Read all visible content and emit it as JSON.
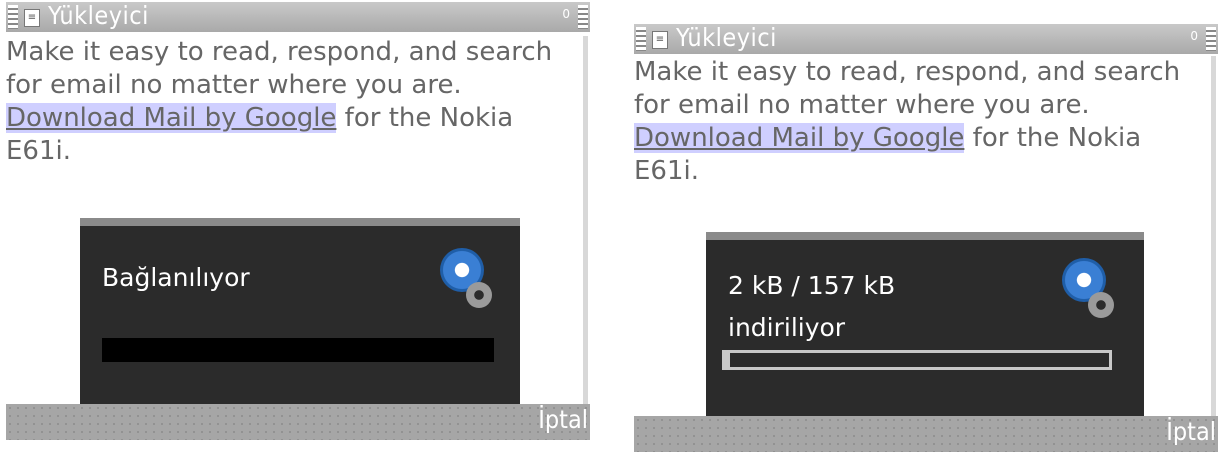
{
  "left_screen": {
    "titlebar": {
      "title": "Yükleyici",
      "counter": "0"
    },
    "content": {
      "line1": "Make it easy to read, respond, and search for email no matter where you are.",
      "link": "Download Mail by Google",
      "after_link": " for the Nokia E61i."
    },
    "dialog": {
      "status": "Bağlanılıyor"
    },
    "softkeys": {
      "right": "İptal"
    }
  },
  "right_screen": {
    "titlebar": {
      "title": "Yükleyici",
      "counter": "0"
    },
    "content": {
      "line1": "Make it easy to read, respond, and search for email no matter where you are.",
      "link": "Download Mail by Google",
      "after_link": " for the Nokia E61i."
    },
    "dialog": {
      "progress_text": "2 kB / 157 kB",
      "status": "indiriliyor",
      "progress": 0.013
    },
    "softkeys": {
      "right": "İptal"
    }
  },
  "icons": [
    "settings-gear-icon",
    "app-icon",
    "signal-icon",
    "battery-icon"
  ],
  "colors": {
    "title_bg": "#b8b8b8",
    "dialog_bg": "#2b2b2b",
    "link_highlight": "#cfcfff",
    "gear_blue": "#3a7fd4"
  }
}
